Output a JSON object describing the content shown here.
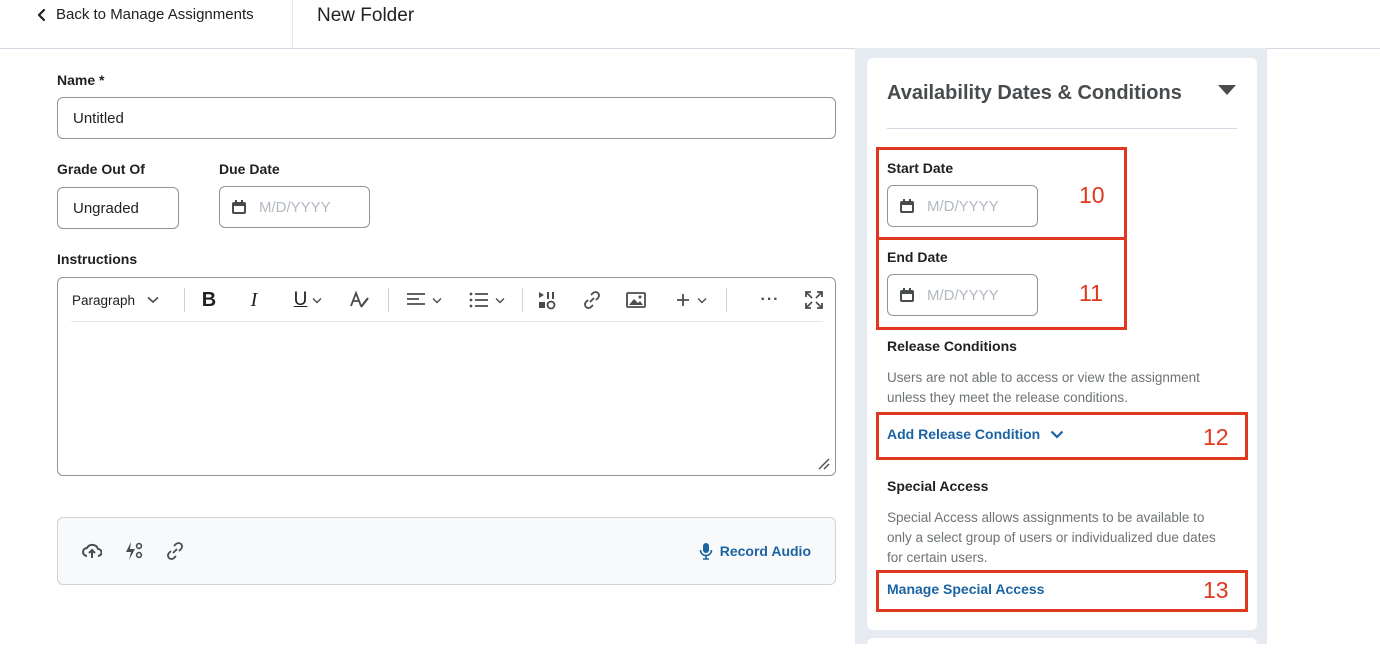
{
  "header": {
    "back_label": "Back to Manage Assignments",
    "page_title": "New Folder"
  },
  "form": {
    "name_label": "Name *",
    "name_value": "Untitled",
    "grade_label": "Grade Out Of",
    "grade_value": "Ungraded",
    "due_label": "Due Date",
    "due_placeholder": "M/D/YYYY",
    "instructions_label": "Instructions",
    "editor_toolbar": {
      "paragraph_label": "Paragraph",
      "bold_label": "B",
      "italic_label": "I",
      "underline_label": "U",
      "more_label": "···"
    },
    "attachments": {
      "record_audio_label": "Record Audio"
    }
  },
  "availability": {
    "title": "Availability Dates & Conditions",
    "start_label": "Start Date",
    "start_placeholder": "M/D/YYYY",
    "end_label": "End Date",
    "end_placeholder": "M/D/YYYY",
    "release_title": "Release Conditions",
    "release_desc_line1": "Users are not able to access or view the assignment",
    "release_desc_line2": "unless they meet the release conditions.",
    "add_release_label": "Add Release Condition",
    "special_title": "Special Access",
    "special_desc_line1": "Special Access allows assignments to be available to",
    "special_desc_line2": "only a select group of users or individualized due dates",
    "special_desc_line3": "for certain users.",
    "manage_special_label": "Manage Special Access"
  },
  "annotations": {
    "n10": "10",
    "n11": "11",
    "n12": "12",
    "n13": "13",
    "color": "#e0371f"
  },
  "colors": {
    "link": "#1b63a3",
    "side_panel": "#e6eaf1"
  }
}
